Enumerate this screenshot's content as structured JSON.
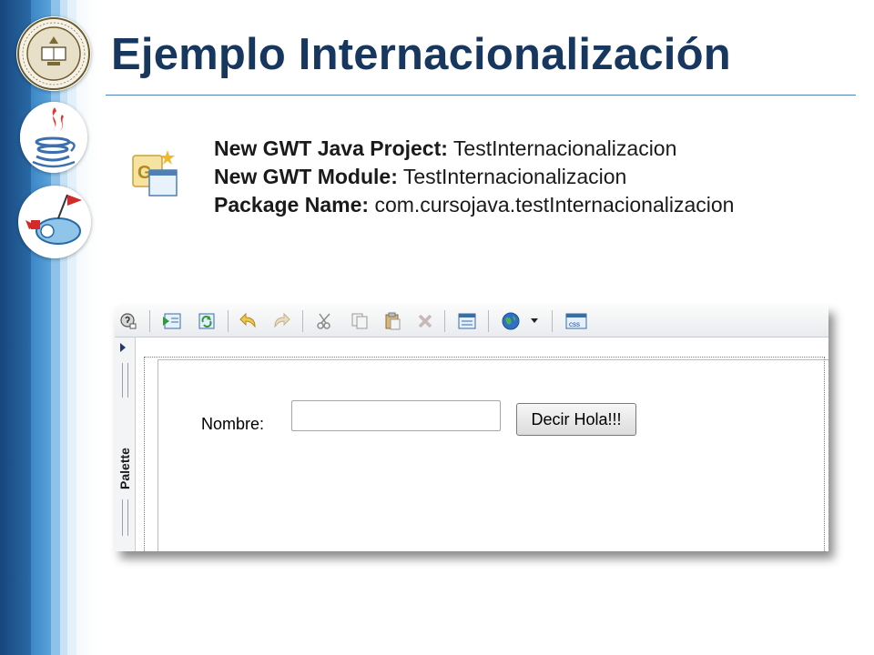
{
  "slide": {
    "title": "Ejemplo Internacionalización"
  },
  "logos": {
    "seal": "university-seal-logo",
    "java": "java-logo",
    "gwt": "gwt-logo"
  },
  "project": {
    "rows": [
      {
        "label": "New GWT Java Project:",
        "value": "TestInternacionalizacion"
      },
      {
        "label": "New GWT Module:",
        "value": "TestInternacionalizacion"
      },
      {
        "label": "Package Name:",
        "value": "com.cursojava.testInternacionalizacion"
      }
    ]
  },
  "editor": {
    "palette_label": "Palette",
    "toolbar_icons": [
      "test-icon",
      "preview-icon",
      "refresh-icon",
      "undo-icon",
      "redo-icon",
      "cut-icon",
      "copy-icon",
      "paste-icon",
      "delete-icon",
      "properties-icon",
      "globe-icon",
      "css-icon"
    ],
    "form": {
      "nombre_label": "Nombre:",
      "nombre_value": "",
      "button_label": "Decir Hola!!!"
    }
  },
  "colors": {
    "title": "#17375e",
    "accent_rule": "#4f81bd",
    "band_dark": "#17467c"
  }
}
